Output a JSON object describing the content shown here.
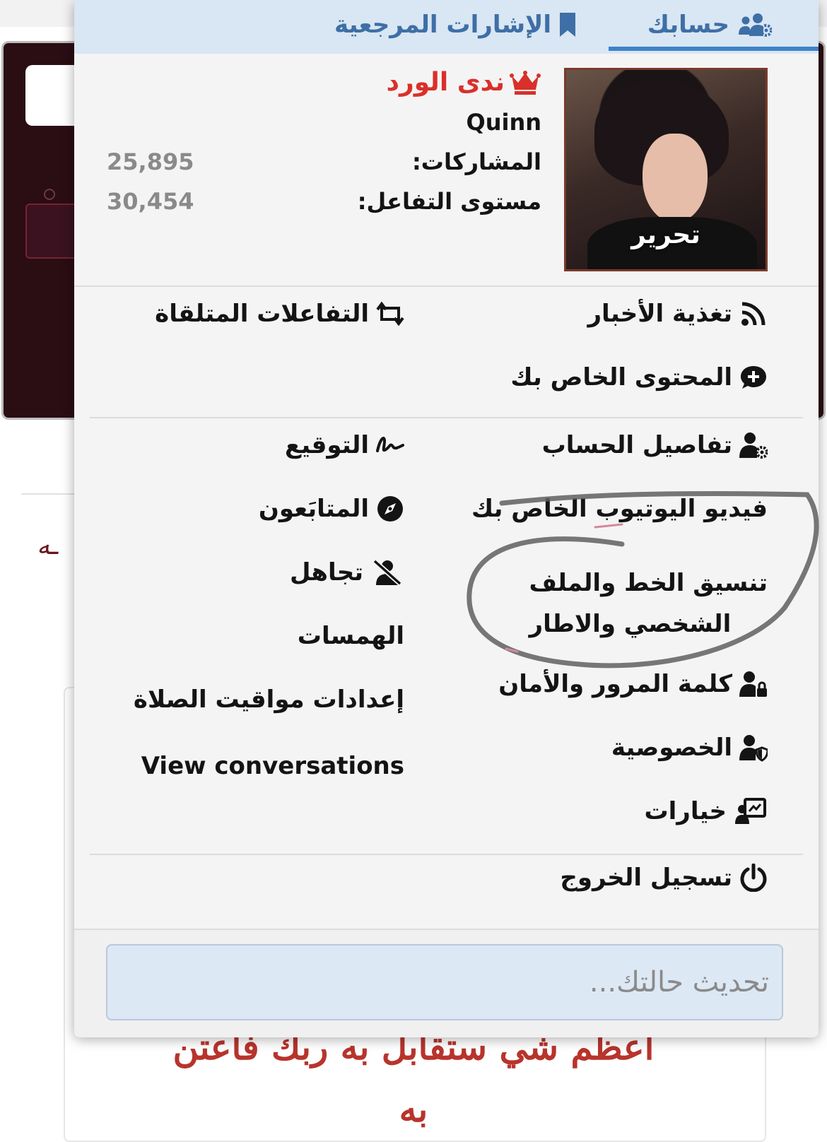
{
  "background": {
    "side_text": "ـه",
    "quote_line1": "أعظم شي ستقابل به ربك فاعتن",
    "quote_line2": "به"
  },
  "tabs": {
    "account": "حسابك",
    "bookmarks": "الإشارات المرجعية"
  },
  "profile": {
    "display_name": "ندى الورد",
    "user_title": "Quinn",
    "avatar_edit_label": "تحرير",
    "posts_label": "المشاركات:",
    "posts_value": "25,895",
    "reaction_label": "مستوى التفاعل:",
    "reaction_value": "30,454"
  },
  "menu": {
    "news_feed": "تغذية الأخبار",
    "reactions_received": "التفاعلات المتلقاة",
    "your_content": "المحتوى الخاص بك",
    "account_details": "تفاصيل الحساب",
    "signature": "التوقيع",
    "youtube_video": "فيديو اليوتيوب الخاص بك",
    "followers": "المتابَعون",
    "font_profile_line1": "تنسيق الخط والملف",
    "font_profile_line2": "الشخصي والاطار",
    "ignore": "تجاهل",
    "whispers": "الهمسات",
    "password_security": "كلمة المرور والأمان",
    "prayer_times": "إعدادات مواقيت الصلاة",
    "privacy": "الخصوصية",
    "view_conversations": "View conversations",
    "options": "خيارات",
    "logout": "تسجيل الخروج"
  },
  "status": {
    "placeholder": "تحديث حالتك..."
  },
  "icons": {
    "account_tab": "users-cog-icon",
    "bookmarks_tab": "bookmark-icon",
    "crown": "crown-icon",
    "news_feed": "rss-icon",
    "reactions": "retweet-icon",
    "content": "comment-plus-icon",
    "account_details": "user-cog-icon",
    "signature": "signature-icon",
    "followers": "compass-icon",
    "ignore": "user-slash-icon",
    "password": "user-lock-icon",
    "privacy": "user-shield-icon",
    "options": "chalkboard-user-icon",
    "logout": "power-icon"
  },
  "colors": {
    "tab_text": "#3e6fa6",
    "tab_bar": "#d9e6f3",
    "username": "#d9302a",
    "stat_value": "#8a8a8a",
    "quote": "#b8342c"
  }
}
